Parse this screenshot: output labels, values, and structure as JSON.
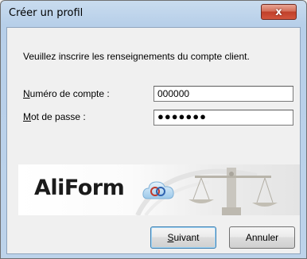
{
  "window": {
    "title": "Créer un profil",
    "close_glyph": "x"
  },
  "form": {
    "intro": "Veuillez inscrire les renseignements du compte client.",
    "account_label_key": "N",
    "account_label_rest": "uméro de compte :",
    "account_value": "000000",
    "password_label_key": "M",
    "password_label_rest": "ot de passe :",
    "password_value": "●●●●●●●"
  },
  "banner": {
    "logo_text": "AliForm",
    "logo_icon": "cloud-icon"
  },
  "buttons": {
    "next_key": "S",
    "next_rest": "uivant",
    "cancel": "Annuler"
  },
  "colors": {
    "close_button": "#c0402a",
    "default_button_border": "#3c7fb1"
  }
}
